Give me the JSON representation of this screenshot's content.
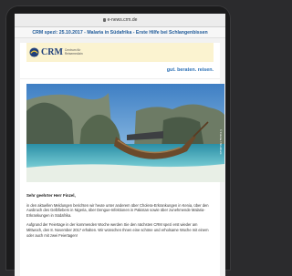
{
  "browser": {
    "url": "e-news.crm.de"
  },
  "email": {
    "subject": "CRM spezi: 25.10.2017 - Malaria in Südafrika - Erste Hilfe bei Schlangenbissen",
    "logo": {
      "name": "CRM",
      "tagline": "Centrum für Reisemedizin"
    },
    "slogan": "gut. beraten. reisen.",
    "hero": {
      "credit": "© Fotolia / Shubham"
    },
    "greeting": "Sehr geehrter Herr Finzel,",
    "paragraphs": [
      "in den aktuellen Meldungen berichten wir heute unter anderem über Cholera-Erkrankungen in Kenia, über den Ausbruch des Gelbfiebers in Nigeria, über Dengue-Infektionen in Pakistan sowie über zunehmende Malaria-Erkrankungen in Südafrika.",
      "Aufgrund der Feiertage in der kommenden Woche werden Sie den nächsten CRM spezi erst wieder am Mittwoch, den 8. November 2017 erhalten. Wir wünschen Ihnen eine schöne und erholsame Woche mit einem oder auch mit zwei Feiertagen!"
    ]
  },
  "colors": {
    "accent": "#1f5a99",
    "logo_band": "#fbf3d0",
    "slogan": "#2a6fb5"
  }
}
